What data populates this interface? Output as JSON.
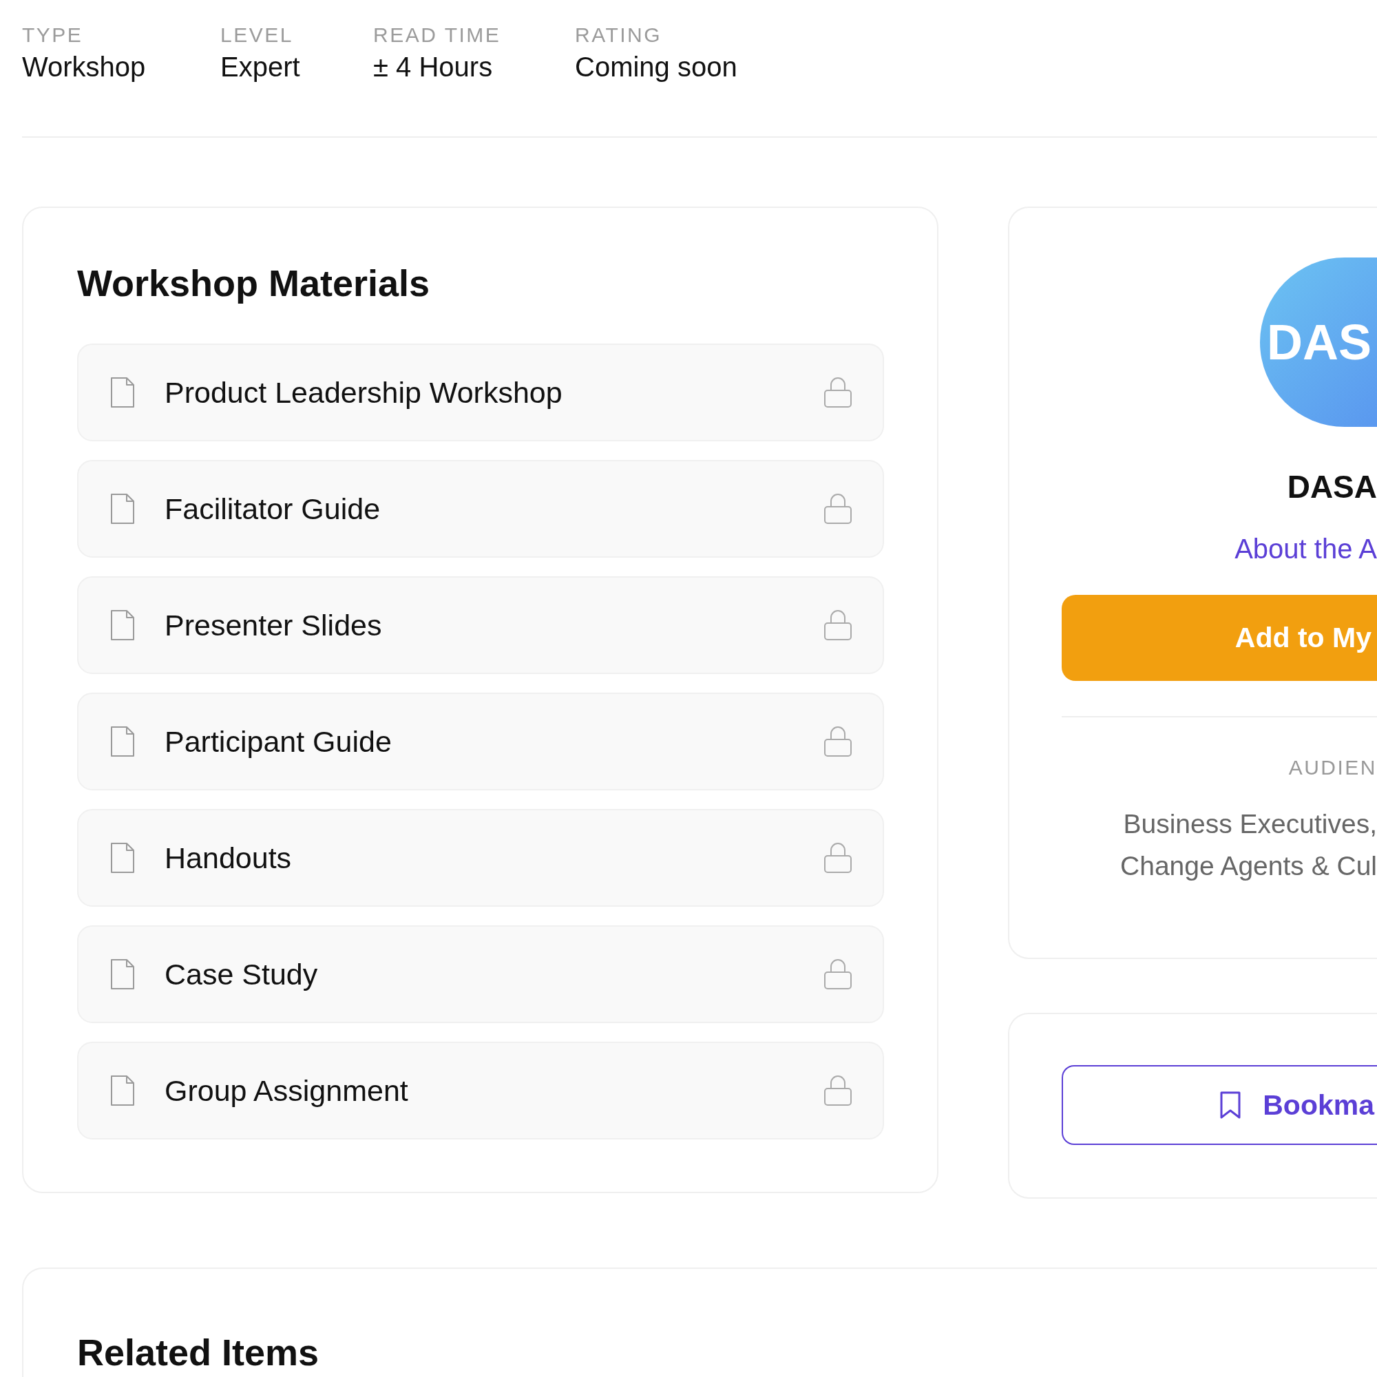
{
  "meta": [
    {
      "label": "TYPE",
      "value": "Workshop"
    },
    {
      "label": "LEVEL",
      "value": "Expert"
    },
    {
      "label": "READ TIME",
      "value": "± 4 Hours"
    },
    {
      "label": "RATING",
      "value": "Coming soon"
    }
  ],
  "materials": {
    "title": "Workshop Materials",
    "items": [
      {
        "title": "Product Leadership Workshop",
        "locked": true
      },
      {
        "title": "Facilitator Guide",
        "locked": true
      },
      {
        "title": "Presenter Slides",
        "locked": true
      },
      {
        "title": "Participant Guide",
        "locked": true
      },
      {
        "title": "Handouts",
        "locked": true
      },
      {
        "title": "Case Study",
        "locked": true
      },
      {
        "title": "Group Assignment",
        "locked": true
      }
    ]
  },
  "author": {
    "avatar_initials": "DAS",
    "name": "DASA",
    "link": "About the A",
    "button": "Add to My",
    "audience_label": "AUDIEN",
    "audience_lines": [
      "Business Executives,",
      "Change Agents & Cul"
    ]
  },
  "bookmark": {
    "button": "Bookma"
  },
  "related": {
    "title": "Related Items"
  }
}
